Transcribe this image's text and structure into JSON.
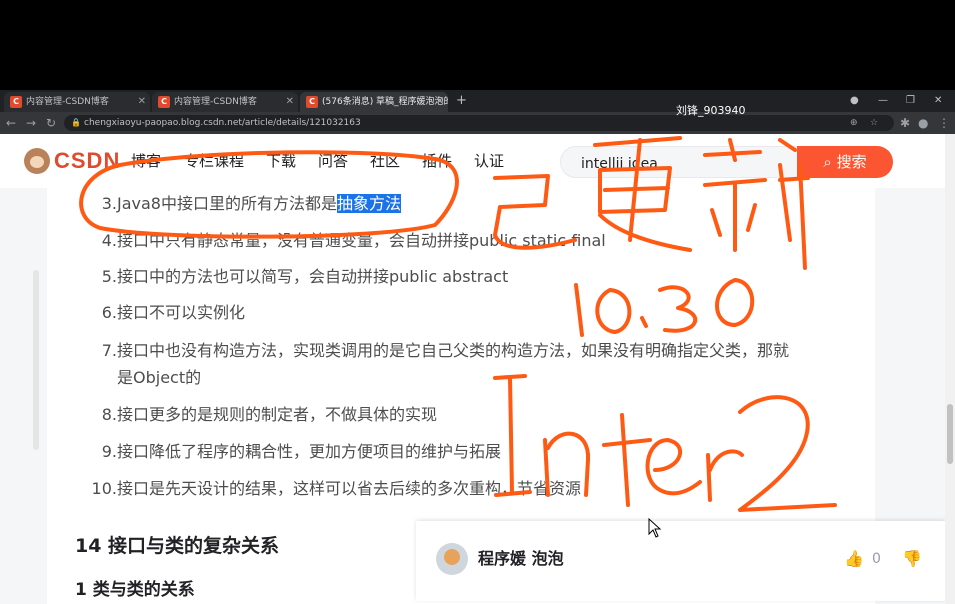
{
  "browser": {
    "tabs": [
      {
        "title": "内容管理-CSDN博客",
        "active": false
      },
      {
        "title": "内容管理-CSDN博客",
        "active": false
      },
      {
        "title": "(576条消息) 草稿_程序媛泡泡的",
        "active": true
      }
    ],
    "url": "chengxiaoyu-paopao.blog.csdn.net/article/details/121032163",
    "overlay_username": "刘锋_903940"
  },
  "csdn": {
    "logo": "CSDN",
    "nav": [
      "博客",
      "专栏课程",
      "下载",
      "问答",
      "社区",
      "插件",
      "认证"
    ],
    "search_value": "intellij idea",
    "search_button": "搜索",
    "accent": "#fc5531"
  },
  "article": {
    "items": [
      {
        "num": "3.",
        "text": "Java8中接口里的所有方法都是",
        "highlight": "抽象方法"
      },
      {
        "num": "4.",
        "text": "接口中只有静态常量，没有普通变量，会自动拼接public static final"
      },
      {
        "num": "5.",
        "text": "接口中的方法也可以简写，会自动拼接public abstract"
      },
      {
        "num": "6.",
        "text": "接口不可以实例化"
      },
      {
        "num": "7.",
        "text": "接口中也没有构造方法，实现类调用的是它自己父类的构造方法，如果没有明确指定父类，那就",
        "text2": "是Object的"
      },
      {
        "num": "8.",
        "text": "接口更多的是规则的制定者，不做具体的实现"
      },
      {
        "num": "9.",
        "text": "接口降低了程序的耦合性，更加方便项目的维护与拓展"
      },
      {
        "num": "10.",
        "text": "接口是先天设计的结果，这样可以省去后续的多次重构，节省资源"
      }
    ],
    "heading14": "14 接口与类的复杂关系",
    "heading1": "1 类与类的关系"
  },
  "author": {
    "name": "程序媛 泡泡",
    "likes": "0"
  },
  "ink_color": "#ff5a14"
}
